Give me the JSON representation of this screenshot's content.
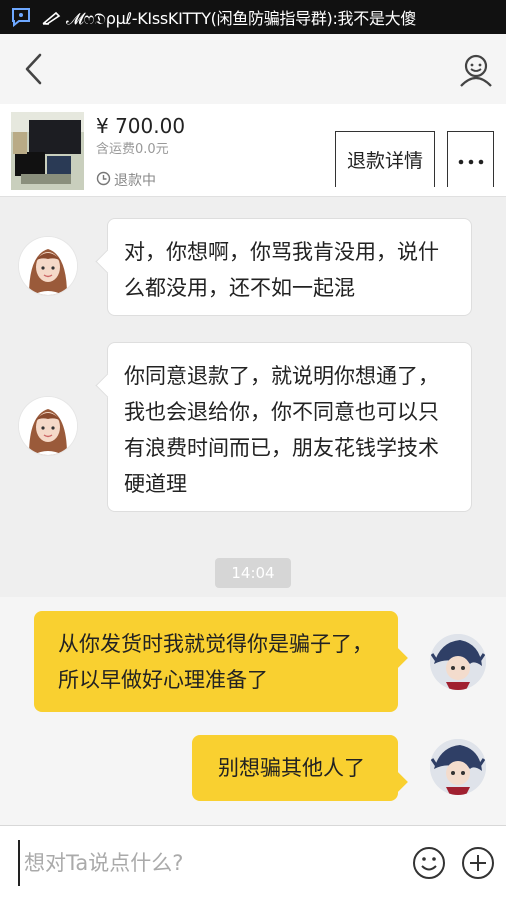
{
  "status_bar": {
    "notification_text": "𝓜ෆ𝔇ρμℓ-KIssKITTY(闲鱼防骗指导群):我不是大傻",
    "app_icon": "chat-bubble-icon",
    "pen_icon": "pen-icon"
  },
  "nav": {
    "back_icon": "chevron-left-icon",
    "profile_icon": "user-icon"
  },
  "product": {
    "price": "¥ 700.00",
    "shipping": "含运费0.0元",
    "status": "退款中",
    "refund_detail_label": "退款详情",
    "more_icon": "ellipsis-icon"
  },
  "chat": {
    "messages": [
      {
        "side": "left",
        "text": "对，你想啊，你骂我肯没用，说什么都没用，还不如一起混"
      },
      {
        "side": "left",
        "text": "你同意退款了，就说明你想通了，我也会退给你，你不同意也可以只有浪费时间而已，朋友花钱学技术硬道理"
      },
      {
        "side": "right",
        "text": "从你发货时我就觉得你是骗子了，所以早做好心理准备了"
      },
      {
        "side": "right",
        "text": "别想骗其他人了"
      }
    ],
    "timestamp": "14:04"
  },
  "input_bar": {
    "placeholder": "想对Ta说点什么?",
    "emoji_icon": "smiley-icon",
    "plus_icon": "plus-circle-icon"
  },
  "colors": {
    "accent_yellow": "#f9d030",
    "status_bar_bg": "#111111",
    "chat_bg": "#efefef"
  }
}
